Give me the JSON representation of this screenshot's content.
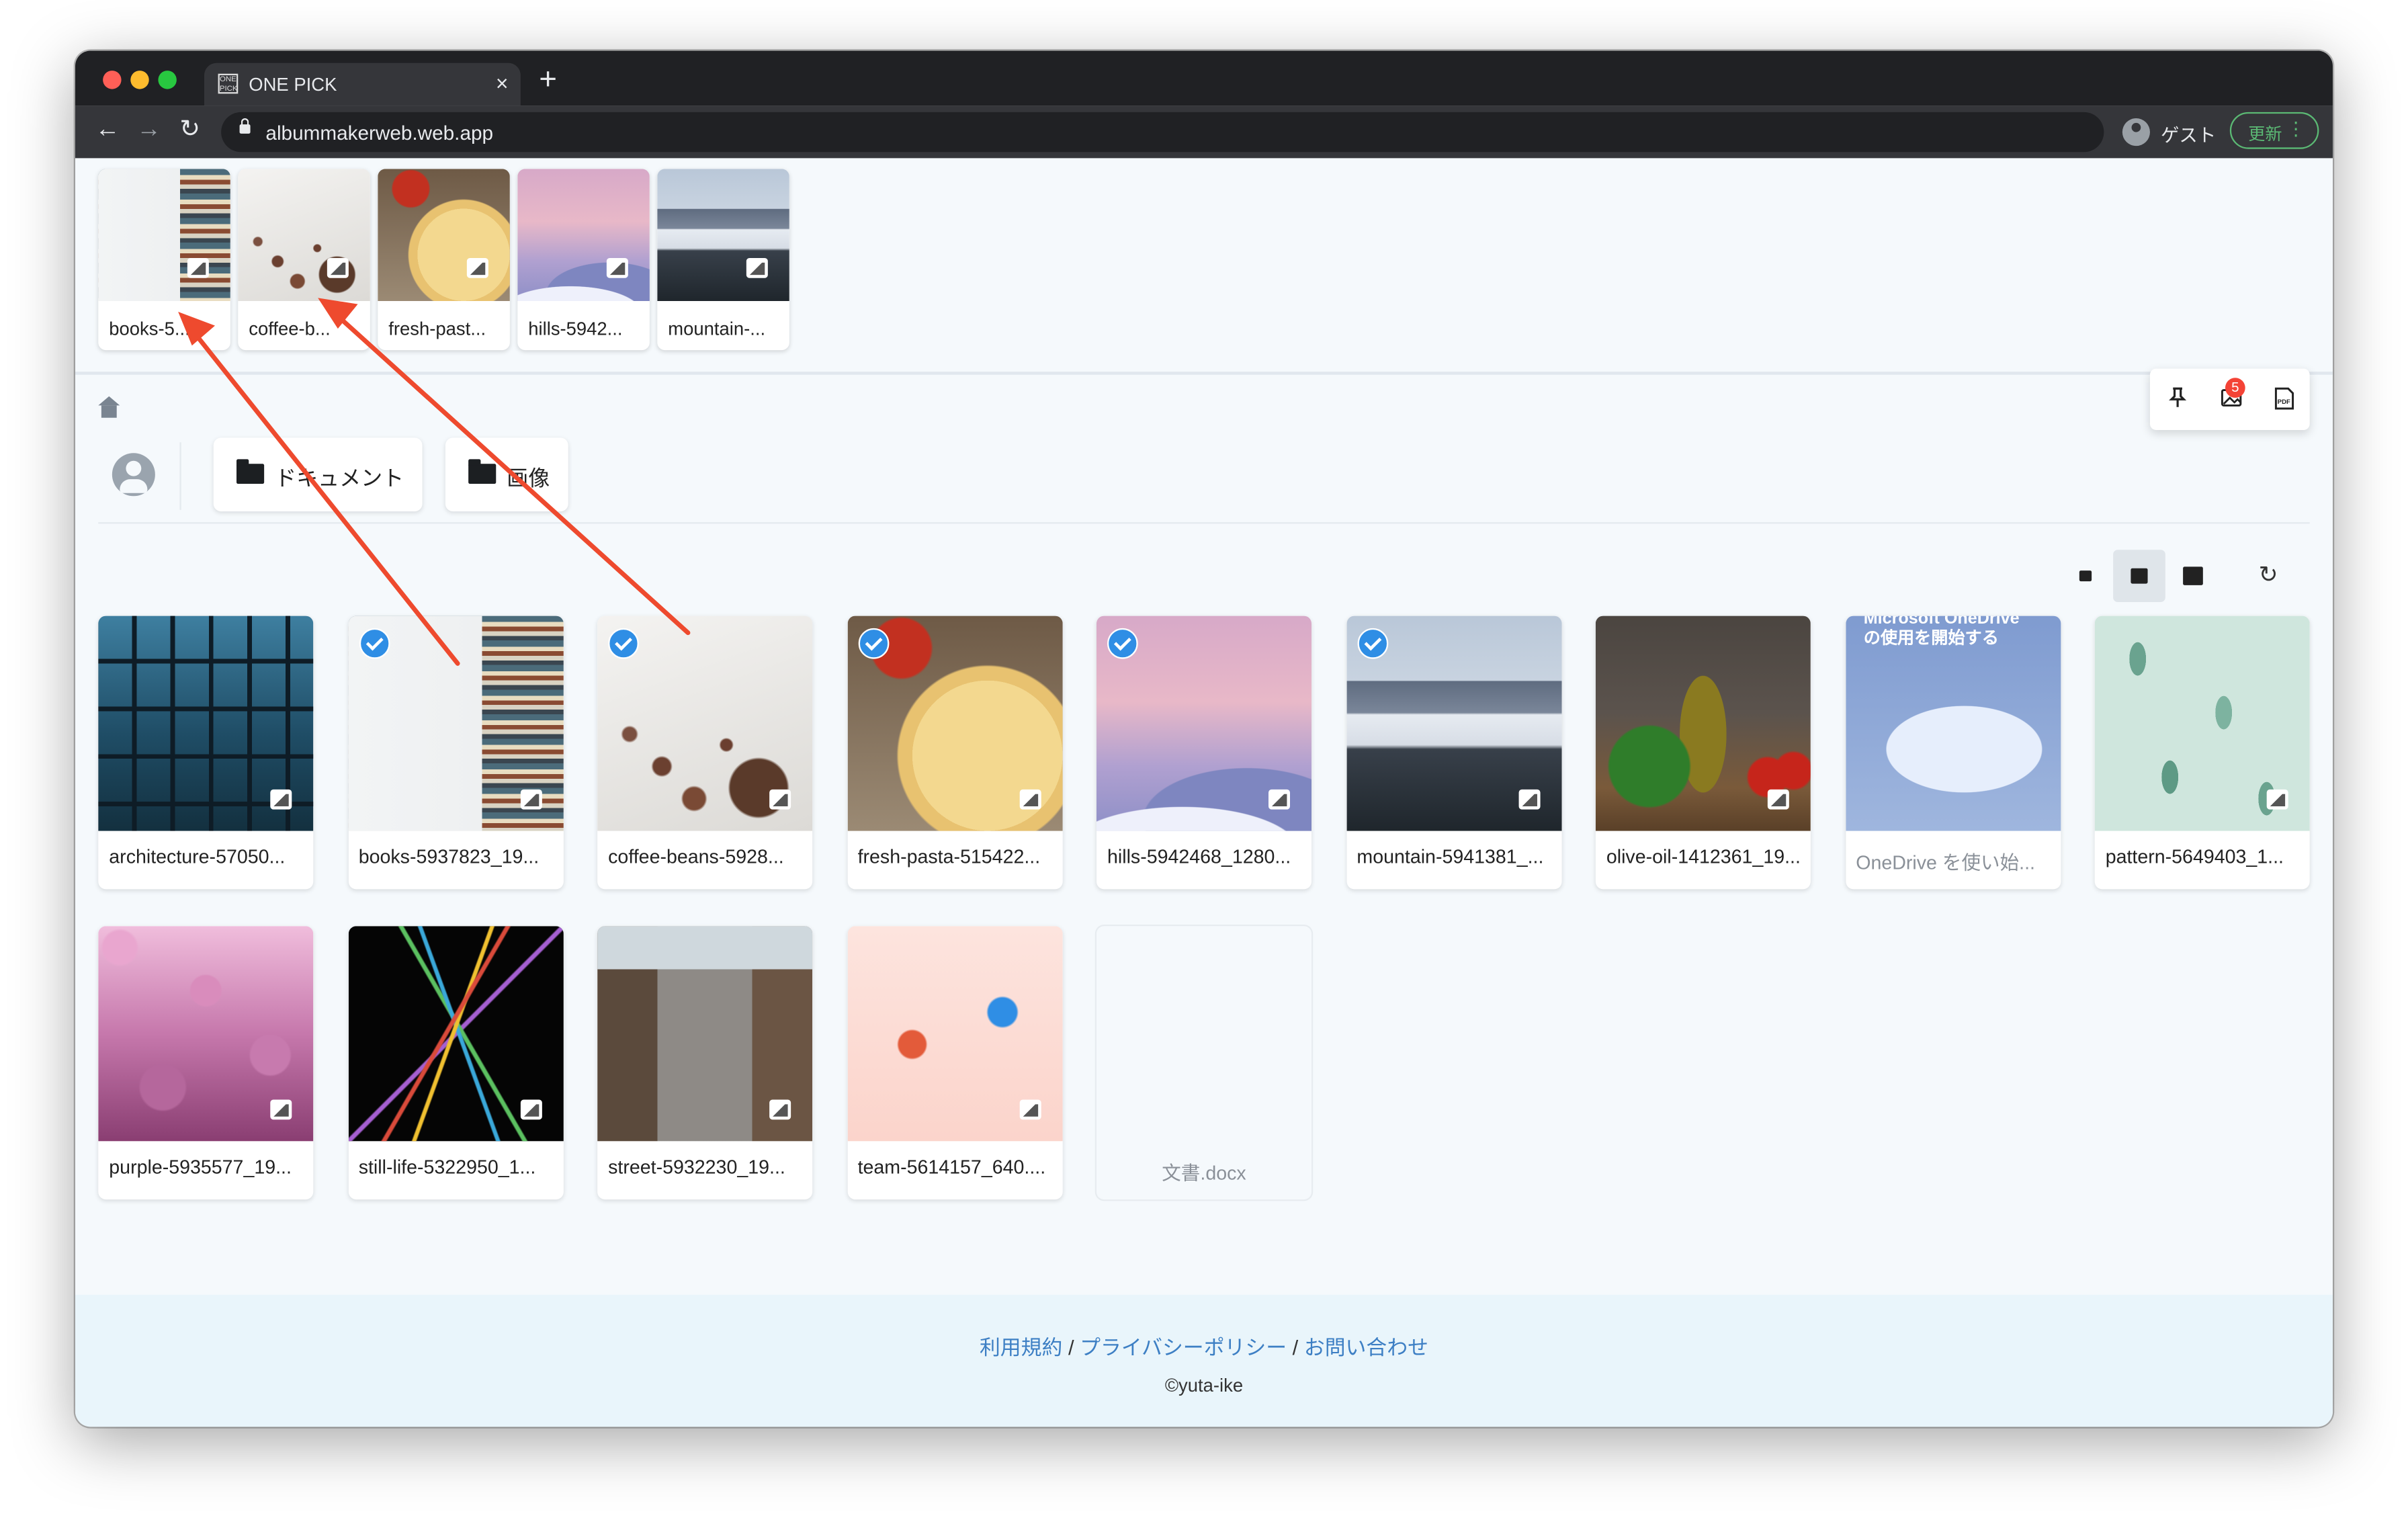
{
  "browser": {
    "tab_title": "ONE PICK",
    "favicon_text": "ONE PICK",
    "tab_close": "×",
    "new_tab": "+",
    "url": "albummakerweb.web.app",
    "profile_label": "ゲスト",
    "update_label": "更新",
    "menu_glyph": "⋮",
    "back_glyph": "←",
    "forward_glyph": "→",
    "reload_glyph": "↻"
  },
  "selected_strip": [
    {
      "label": "books-5...",
      "image": "books"
    },
    {
      "label": "coffee-b...",
      "image": "coffee"
    },
    {
      "label": "fresh-past...",
      "image": "pasta"
    },
    {
      "label": "hills-5942...",
      "image": "hills"
    },
    {
      "label": "mountain-...",
      "image": "mountain"
    }
  ],
  "actions": {
    "pin_glyph": "📌",
    "images_badge_count": "5",
    "pdf_label": "PDF"
  },
  "folders": [
    {
      "label": "ドキュメント"
    },
    {
      "label": "画像"
    }
  ],
  "refresh_glyph": "↻",
  "files": [
    {
      "label": "architecture-57050...",
      "image": "architecture",
      "checked": false
    },
    {
      "label": "books-5937823_19...",
      "image": "books",
      "checked": true
    },
    {
      "label": "coffee-beans-5928...",
      "image": "coffee",
      "checked": true
    },
    {
      "label": "fresh-pasta-515422...",
      "image": "pasta",
      "checked": true
    },
    {
      "label": "hills-5942468_1280...",
      "image": "hills",
      "checked": true
    },
    {
      "label": "mountain-5941381_...",
      "image": "mountain",
      "checked": true
    },
    {
      "label": "olive-oil-1412361_19...",
      "image": "olive",
      "checked": false
    },
    {
      "label": "OneDrive を使い始...",
      "image": "onedrive",
      "checked": false
    },
    {
      "label": "pattern-5649403_1...",
      "image": "pattern",
      "checked": false
    },
    {
      "label": "purple-5935577_19...",
      "image": "purple",
      "checked": false
    },
    {
      "label": "still-life-5322950_1...",
      "image": "stilllife",
      "checked": false
    },
    {
      "label": "street-5932230_19...",
      "image": "street",
      "checked": false
    },
    {
      "label": "team-5614157_640....",
      "image": "team",
      "checked": false
    },
    {
      "label": "文書.docx",
      "image": "docx",
      "checked": false
    }
  ],
  "onedrive_thumb": {
    "heading_partial": "Microsoft OneDrive",
    "heading": "の使用を開始する"
  },
  "footer": {
    "terms": "利用規約",
    "sep1": " / ",
    "privacy": "プライバシーポリシー",
    "sep2": " / ",
    "contact": "お問い合わせ",
    "copyright": "©yuta-ike"
  }
}
